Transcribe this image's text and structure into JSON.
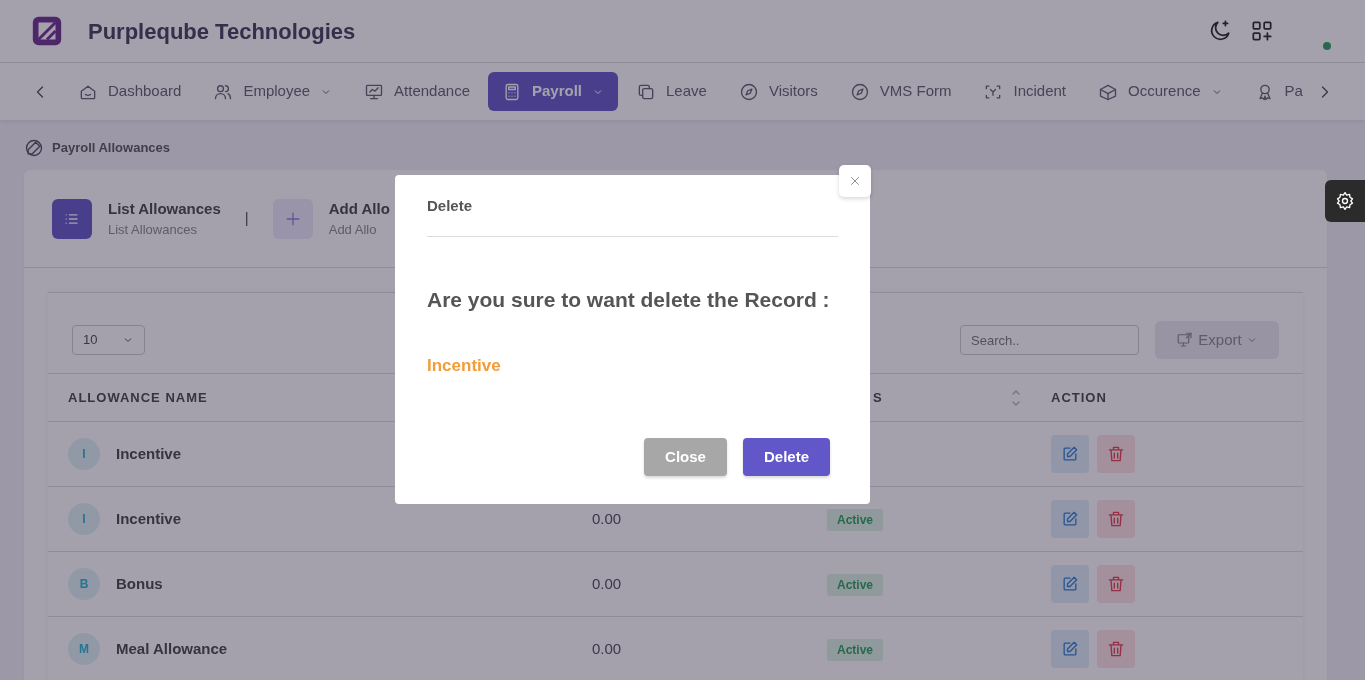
{
  "header": {
    "brand": "Purpleqube Technologies",
    "online": true
  },
  "nav": [
    {
      "label": "Dashboard",
      "kind": "home",
      "dropdown": false,
      "selected": false
    },
    {
      "label": "Employee",
      "kind": "users",
      "dropdown": true,
      "selected": false
    },
    {
      "label": "Attendance",
      "kind": "monitor",
      "dropdown": false,
      "selected": false
    },
    {
      "label": "Payroll",
      "kind": "calculator",
      "dropdown": true,
      "selected": true
    },
    {
      "label": "Leave",
      "kind": "copy",
      "dropdown": false,
      "selected": false
    },
    {
      "label": "Visitors",
      "kind": "compass",
      "dropdown": false,
      "selected": false
    },
    {
      "label": "VMS Form",
      "kind": "compass",
      "dropdown": false,
      "selected": false
    },
    {
      "label": "Incident",
      "kind": "focus",
      "dropdown": false,
      "selected": false
    },
    {
      "label": "Occurence",
      "kind": "boxes",
      "dropdown": true,
      "selected": false
    },
    {
      "label": "Pa",
      "kind": "award",
      "dropdown": false,
      "selected": false
    }
  ],
  "breadcrumb": "Payroll Allowances",
  "tabs": [
    {
      "title": "List Allowances",
      "subtitle": "List Allowances",
      "kind": "list",
      "selected": true
    },
    {
      "title": "Add Allo",
      "subtitle": "Add Allo",
      "kind": "plus",
      "selected": false
    }
  ],
  "tab_separator": "|",
  "toolbar": {
    "page_size": "10",
    "search_placeholder": "Search..",
    "export": "Export"
  },
  "table": {
    "columns": [
      {
        "label": "ALLOWANCE NAME"
      },
      {
        "label": "S",
        "sortable": true
      },
      {
        "label": "ACTION"
      }
    ],
    "rows": [
      {
        "initial": "I",
        "name": "Incentive"
      },
      {
        "initial": "I",
        "name": "Incentive",
        "amount": "0.00",
        "status": "Active"
      },
      {
        "initial": "B",
        "name": "Bonus",
        "amount": "0.00",
        "status": "Active"
      },
      {
        "initial": "M",
        "name": "Meal Allowance",
        "amount": "0.00",
        "status": "Active"
      }
    ]
  },
  "modal": {
    "title": "Delete",
    "message": "Are you sure to want delete the Record :",
    "record": "Incentive",
    "buttons": [
      {
        "label": "Close",
        "kind": "secondary"
      },
      {
        "label": "Delete",
        "kind": "primary"
      }
    ]
  }
}
